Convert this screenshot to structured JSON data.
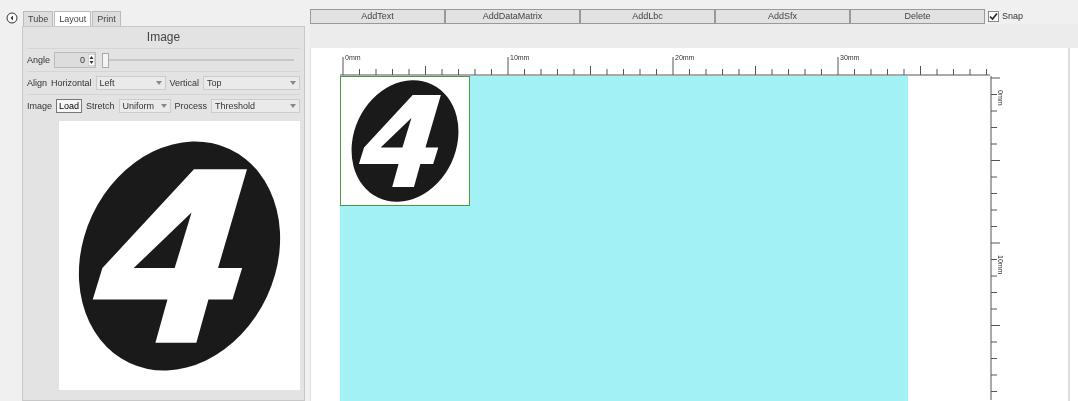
{
  "tabs": [
    {
      "label": "Tube",
      "selected": false
    },
    {
      "label": "Layout",
      "selected": true
    },
    {
      "label": "Print",
      "selected": false
    }
  ],
  "panel": {
    "title": "Image",
    "angle": {
      "label": "Angle",
      "value": "0",
      "level": 0
    },
    "align": {
      "label": "Align",
      "horizontal_label": "Horizontal",
      "horizontal": "Left",
      "vertical_label": "Vertical",
      "vertical": "Top"
    },
    "image": {
      "label": "Image",
      "load": "Load",
      "stretch_label": "Stretch",
      "stretch": "Uniform",
      "process_label": "Process",
      "process": "Threshold"
    }
  },
  "toolbar": [
    "AddText",
    "AddDataMatrix",
    "AddLbc",
    "AddSfx",
    "Delete"
  ],
  "snap": {
    "label": "Snap",
    "checked": true
  },
  "rulers": {
    "horizontal": [
      "0mm",
      "10mm",
      "20mm",
      "30mm"
    ],
    "vertical": [
      "0mm",
      "10mm"
    ]
  }
}
